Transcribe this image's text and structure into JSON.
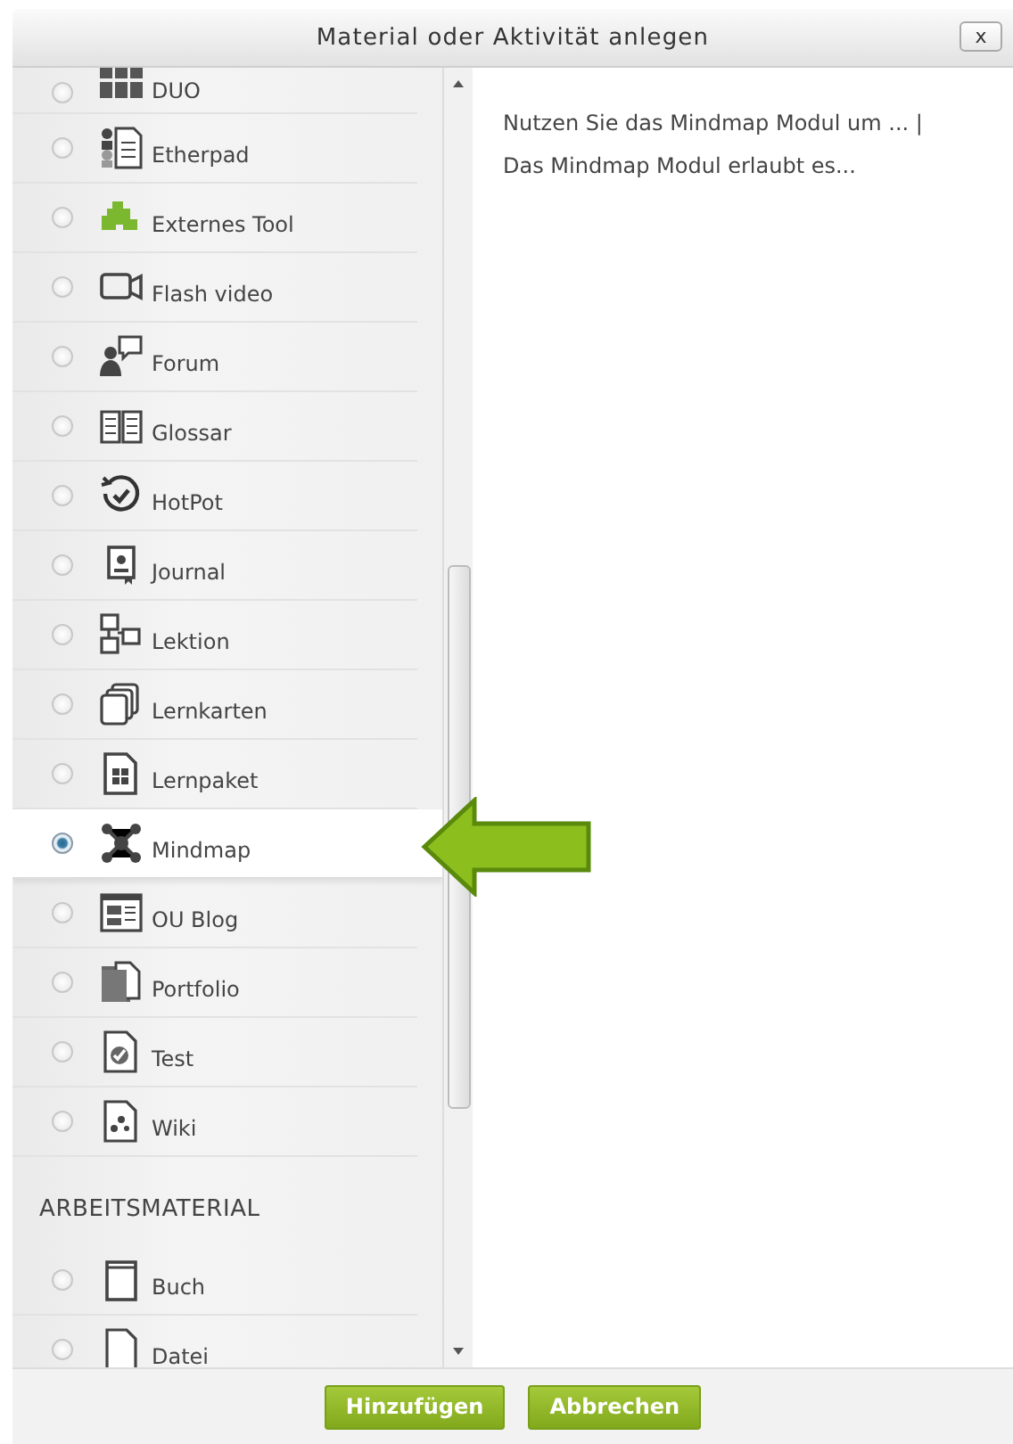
{
  "dialog": {
    "title": "Material oder Aktivität anlegen",
    "close": "x"
  },
  "activities": [
    {
      "label": "DUO",
      "selected": false
    },
    {
      "label": "Etherpad",
      "selected": false
    },
    {
      "label": "Externes Tool",
      "selected": false
    },
    {
      "label": "Flash video",
      "selected": false
    },
    {
      "label": "Forum",
      "selected": false
    },
    {
      "label": "Glossar",
      "selected": false
    },
    {
      "label": "HotPot",
      "selected": false
    },
    {
      "label": "Journal",
      "selected": false
    },
    {
      "label": "Lektion",
      "selected": false
    },
    {
      "label": "Lernkarten",
      "selected": false
    },
    {
      "label": "Lernpaket",
      "selected": false
    },
    {
      "label": "Mindmap",
      "selected": true
    },
    {
      "label": "OU Blog",
      "selected": false
    },
    {
      "label": "Portfolio",
      "selected": false
    },
    {
      "label": "Test",
      "selected": false
    },
    {
      "label": "Wiki",
      "selected": false
    }
  ],
  "resources": {
    "heading": "ARBEITSMATERIAL",
    "items": [
      {
        "label": "Buch",
        "selected": false
      },
      {
        "label": "Datei",
        "selected": false
      }
    ]
  },
  "description": [
    "Nutzen Sie das Mindmap Modul um ... |",
    "Das Mindmap Modul erlaubt es..."
  ],
  "buttons": [
    "Hinzufügen",
    "Abbrechen"
  ]
}
